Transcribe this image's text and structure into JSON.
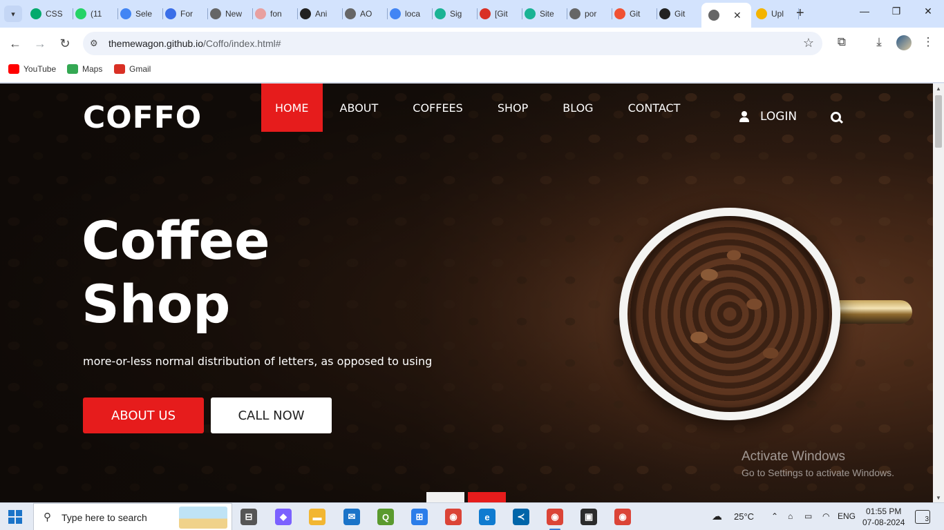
{
  "browser": {
    "tabs": [
      {
        "label": "CSS",
        "icon": "w3schools-icon",
        "color": "#04aa6d"
      },
      {
        "label": "(11",
        "icon": "whatsapp-icon",
        "color": "#25d366"
      },
      {
        "label": "Sele",
        "icon": "google-docs-icon",
        "color": "#4285f4"
      },
      {
        "label": "For",
        "icon": "forms-icon",
        "color": "#3a6ee8"
      },
      {
        "label": "New",
        "icon": "chrome-icon",
        "color": "#666666"
      },
      {
        "label": "fon",
        "icon": "code-icon",
        "color": "#e8a0a0"
      },
      {
        "label": "Ani",
        "icon": "diamond-icon",
        "color": "#222222"
      },
      {
        "label": "AO",
        "icon": "globe-icon",
        "color": "#666666"
      },
      {
        "label": "loca",
        "icon": "google-icon",
        "color": "#4285f4"
      },
      {
        "label": "Sig",
        "icon": "kite-icon",
        "color": "#1ab394"
      },
      {
        "label": "[Git",
        "icon": "gmail-icon",
        "color": "#d93025"
      },
      {
        "label": "Site",
        "icon": "kite-icon",
        "color": "#1ab394"
      },
      {
        "label": "por",
        "icon": "globe-icon",
        "color": "#666666"
      },
      {
        "label": "Git",
        "icon": "git-icon",
        "color": "#f05133"
      },
      {
        "label": "Git",
        "icon": "github-icon",
        "color": "#222222"
      },
      {
        "label": "",
        "icon": "globe-icon",
        "color": "#666666",
        "active": true
      },
      {
        "label": "Upl",
        "icon": "upload-icon",
        "color": "#f4b400"
      }
    ],
    "url_host": "themewagon.github.io",
    "url_path": "/Coffo/index.html#",
    "bookmarks": [
      {
        "label": "YouTube",
        "icon": "youtube-icon",
        "color": "#ff0000"
      },
      {
        "label": "Maps",
        "icon": "maps-icon",
        "color": "#34a853"
      },
      {
        "label": "Gmail",
        "icon": "gmail-icon",
        "color": "#d93025"
      }
    ]
  },
  "site": {
    "logo": "COFFO",
    "menu": [
      {
        "label": "HOME",
        "active": true
      },
      {
        "label": "ABOUT"
      },
      {
        "label": "COFFEES"
      },
      {
        "label": "SHOP"
      },
      {
        "label": "BLOG"
      },
      {
        "label": "CONTACT"
      }
    ],
    "login_label": "LOGIN",
    "hero": {
      "title_line1": "Coffee",
      "title_line2": "Shop",
      "subtitle": "more-or-less normal distribution of letters, as opposed to using",
      "btn_about": "ABOUT US",
      "btn_call": "CALL NOW"
    },
    "accent_color": "#e61c1c",
    "watermark": {
      "title": "Activate Windows",
      "subtitle": "Go to Settings to activate Windows."
    }
  },
  "taskbar": {
    "search_placeholder": "Type here to search",
    "weather": "25°C",
    "language": "ENG",
    "time": "01:55 PM",
    "date": "07-08-2024",
    "notifications": "3",
    "apps": [
      {
        "name": "task-view-icon",
        "color": "#555555"
      },
      {
        "name": "copilot-icon",
        "color": "#7b61ff"
      },
      {
        "name": "file-explorer-icon",
        "color": "#f2b632"
      },
      {
        "name": "mail-icon",
        "color": "#1a73c8"
      },
      {
        "name": "qgis-icon",
        "color": "#5a9a2e"
      },
      {
        "name": "store-icon",
        "color": "#2b7de9"
      },
      {
        "name": "chrome-icon",
        "color": "#db4437"
      },
      {
        "name": "edge-icon",
        "color": "#0f7bd0"
      },
      {
        "name": "vscode-icon",
        "color": "#0065a9"
      },
      {
        "name": "chrome-profile-icon",
        "color": "#db4437",
        "running": true
      },
      {
        "name": "terminal-icon",
        "color": "#2b2b2b"
      },
      {
        "name": "chrome-profile2-icon",
        "color": "#db4437"
      }
    ]
  }
}
